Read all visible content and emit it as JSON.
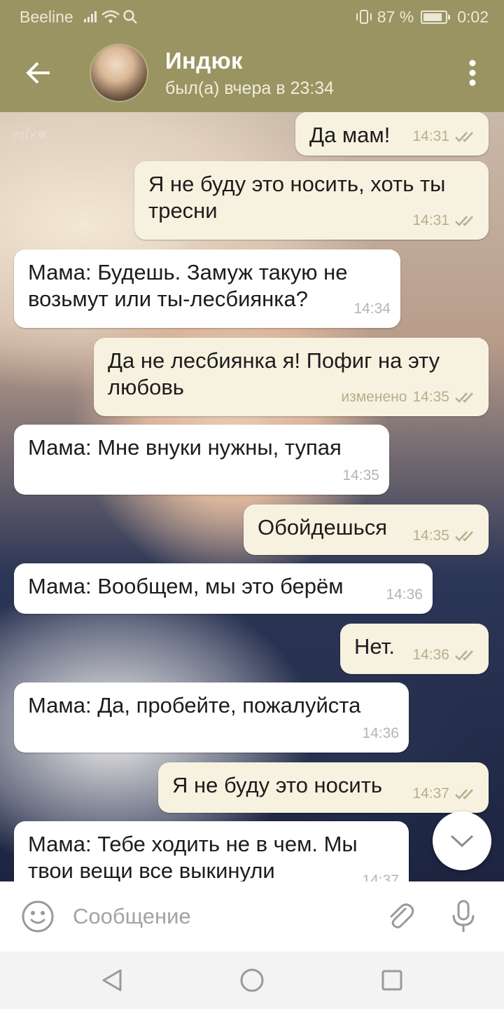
{
  "status_bar": {
    "carrier": "Beeline",
    "battery_text": "87 %",
    "battery_level": 0.87,
    "time": "0:02"
  },
  "header": {
    "contact_name": "Индюк",
    "last_seen": "был(а) вчера в 23:34",
    "icons": [
      "arrow-back-icon",
      "avatar",
      "more-vert-icon"
    ]
  },
  "chat": {
    "watermark": "ᥱᥲᥣ⸙❄",
    "messages": [
      {
        "dir": "out",
        "text": "Да мам!",
        "time": "14:31",
        "edited": ""
      },
      {
        "dir": "out",
        "text": "Я не буду это носить, хоть ты тресни",
        "time": "14:31",
        "edited": ""
      },
      {
        "dir": "in",
        "text": "Мама: Будешь. Замуж такую не возьмут или ты-лесбиянка?",
        "time": "14:34",
        "edited": ""
      },
      {
        "dir": "out",
        "text": "Да не лесбиянка я! Пофиг на эту любовь",
        "time": "14:35",
        "edited": "изменено"
      },
      {
        "dir": "in",
        "text": "Мама: Мне внуки нужны, тупая",
        "time": "14:35",
        "edited": ""
      },
      {
        "dir": "out",
        "text": "Обойдешься",
        "time": "14:35",
        "edited": ""
      },
      {
        "dir": "in",
        "text": "Мама: Вообщем, мы это берём",
        "time": "14:36",
        "edited": ""
      },
      {
        "dir": "out",
        "text": "Нет.",
        "time": "14:36",
        "edited": ""
      },
      {
        "dir": "in",
        "text": "Мама: Да, пробейте, пожалуйста",
        "time": "14:36",
        "edited": ""
      },
      {
        "dir": "out",
        "text": "Я не буду это носить",
        "time": "14:37",
        "edited": ""
      },
      {
        "dir": "in",
        "text": "Мама: Тебе ходить не в чем. Мы твои вещи все выкинули",
        "time": "14:37",
        "edited": ""
      }
    ]
  },
  "input": {
    "placeholder": "Сообщение",
    "value": ""
  },
  "colors": {
    "header_bg": "#9a9463",
    "outgoing_bubble": "#f7f2df",
    "incoming_bubble": "#ffffff",
    "read_check": "#b6ae8e"
  }
}
